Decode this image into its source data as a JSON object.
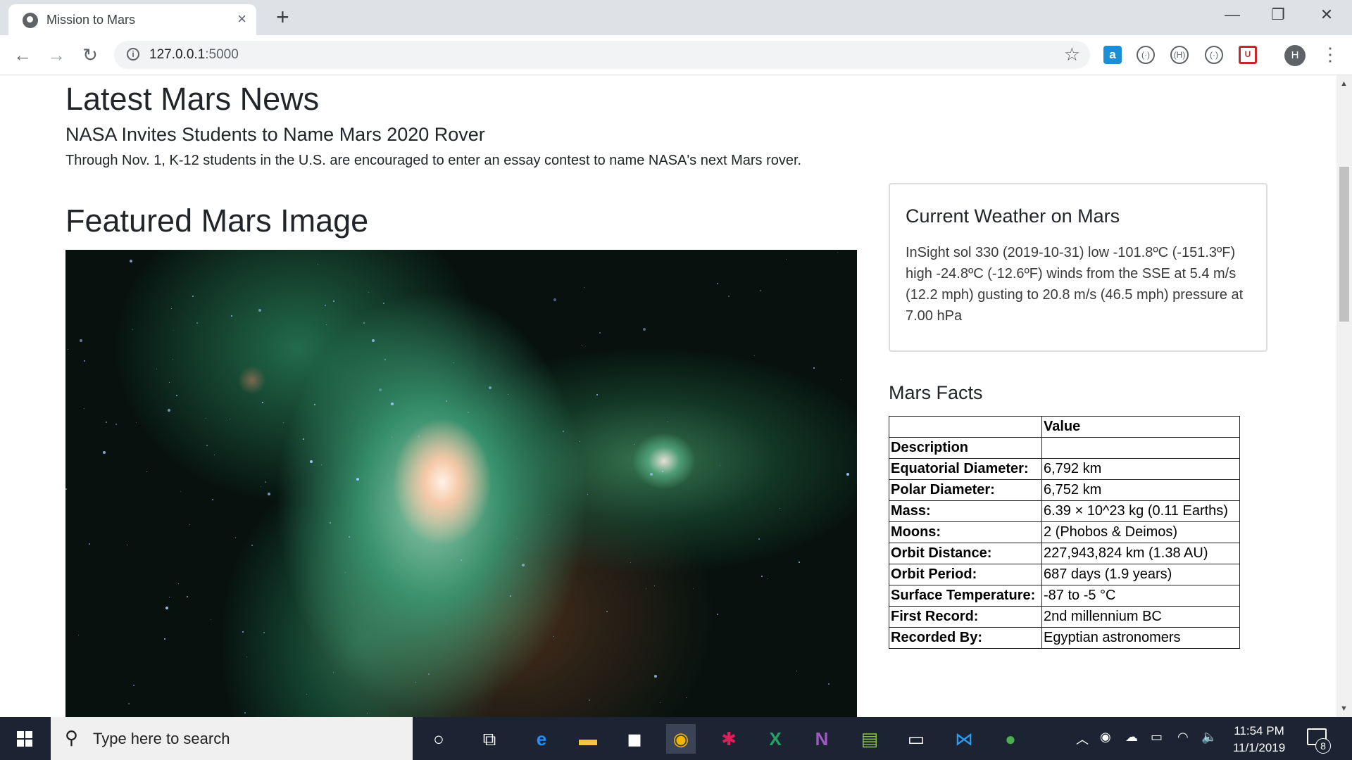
{
  "browser": {
    "tab_title": "Mission to Mars",
    "tab_close": "×",
    "new_tab": "+",
    "url_host": "127.0.0.1",
    "url_port": ":5000",
    "profile_initial": "H",
    "window_controls": {
      "minimize": "—",
      "maximize": "❐",
      "close": "✕"
    },
    "nav": {
      "back": "←",
      "forward": "→",
      "reload": "↻"
    },
    "extensions": [
      "a",
      "(·)",
      "(H)",
      "(·)",
      "U"
    ]
  },
  "news": {
    "section_title": "Latest Mars News",
    "headline": "NASA Invites Students to Name Mars 2020 Rover",
    "teaser": "Through Nov. 1, K-12 students in the U.S. are encouraged to enter an essay contest to name NASA's next Mars rover."
  },
  "featured": {
    "section_title": "Featured Mars Image"
  },
  "weather": {
    "title": "Current Weather on Mars",
    "text": "InSight sol 330 (2019-10-31) low -101.8ºC (-151.3ºF) high -24.8ºC (-12.6ºF) winds from the SSE at 5.4 m/s (12.2 mph) gusting to 20.8 m/s (46.5 mph) pressure at 7.00 hPa"
  },
  "facts": {
    "title": "Mars Facts",
    "header": [
      "",
      "Value"
    ],
    "rows": [
      [
        "Description",
        ""
      ],
      [
        "Equatorial Diameter:",
        "6,792 km"
      ],
      [
        "Polar Diameter:",
        "6,752 km"
      ],
      [
        "Mass:",
        "6.39 × 10^23 kg (0.11 Earths)"
      ],
      [
        "Moons:",
        "2 (Phobos & Deimos)"
      ],
      [
        "Orbit Distance:",
        "227,943,824 km (1.38 AU)"
      ],
      [
        "Orbit Period:",
        "687 days (1.9 years)"
      ],
      [
        "Surface Temperature:",
        "-87 to -5 °C"
      ],
      [
        "First Record:",
        "2nd millennium BC"
      ],
      [
        "Recorded By:",
        "Egyptian astronomers"
      ]
    ]
  },
  "taskbar": {
    "search_placeholder": "Type here to search",
    "time": "11:54 PM",
    "date": "11/1/2019",
    "notification_count": "8"
  }
}
